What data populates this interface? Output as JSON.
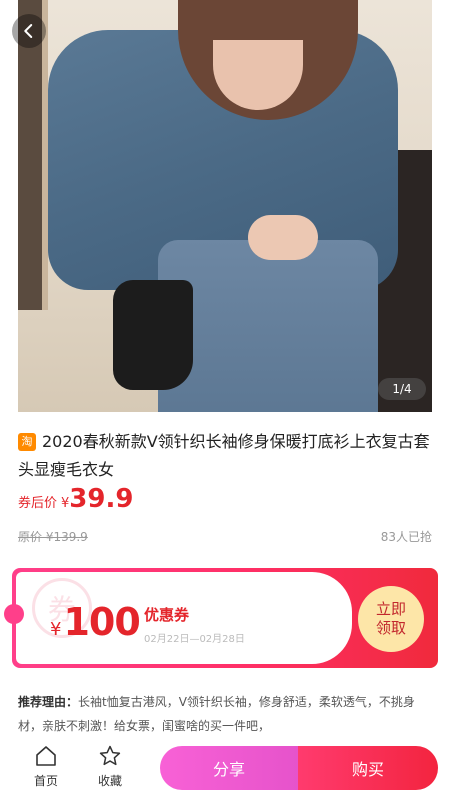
{
  "product": {
    "image_counter": "1/4",
    "platform_badge": "淘",
    "title": "2020春秋新款V领针织长袖修身保暖打底衫上衣复古套头显瘦毛衣女",
    "price_label": "券后价",
    "price_symbol": "¥",
    "price": "39.9",
    "original_price": "原价 ¥139.9",
    "sold": "83人已抢"
  },
  "coupon": {
    "seal_text": "券",
    "symbol": "¥",
    "amount": "100",
    "name": "优惠券",
    "date_range": "02月22日—02月28日",
    "claim_label_1": "立即",
    "claim_label_2": "领取"
  },
  "recommend": {
    "label": "推荐理由：",
    "text": "长袖t恤复古港风，V领针织长袖，修身舒适，柔软透气，不挑身材，亲肤不刺激！给女票，闺蜜啥的买一件吧，"
  },
  "bottom_bar": {
    "home_label": "首页",
    "fav_label": "收藏",
    "share_label": "分享",
    "buy_label": "购买"
  },
  "colors": {
    "accent_red": "#e4252b",
    "coupon_pink": "#ff3f8a",
    "share_pink": "#f861d6",
    "claim_gold": "#fde6a8"
  },
  "icons": [
    "back-icon",
    "home-icon",
    "star-icon"
  ]
}
